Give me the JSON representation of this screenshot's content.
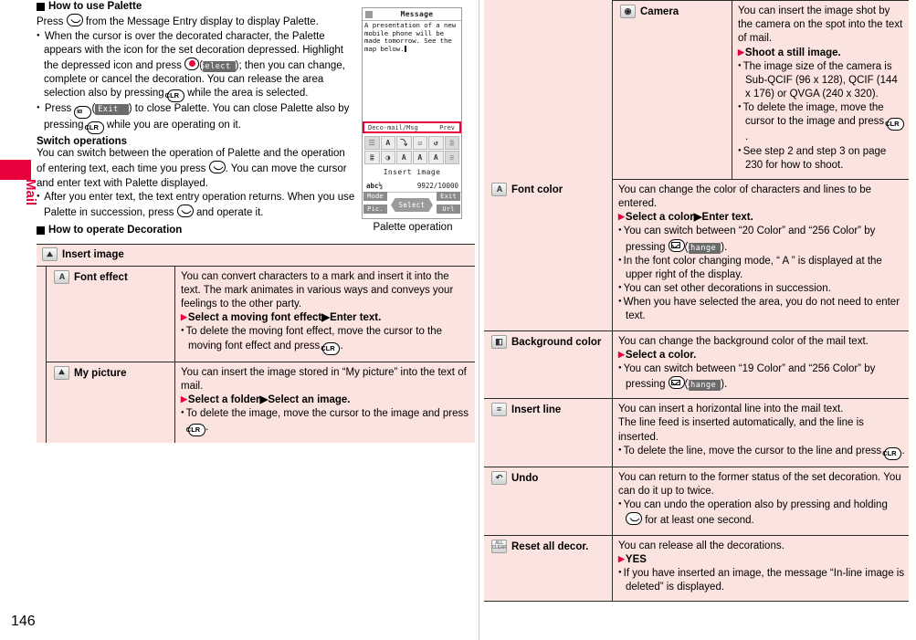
{
  "page": {
    "number": "146",
    "side_tab": "Mail",
    "accent": "#e8003c",
    "table_bg": "#fbe3e0"
  },
  "left": {
    "h1": "How to use Palette",
    "p1_a": "Press",
    "p1_b": "from the Message Entry display to display Palette.",
    "b1": "When the cursor is over the decorated character, the Palette appears with the icon for the set decoration depressed. Highlight the depressed icon and press",
    "b1_softkey": "Select",
    "b1_cont": "); then you can change, complete or cancel the decoration. You can release the area selection also by pressing",
    "b1_end": "while the area is selected.",
    "b2_a": "Press",
    "b2_key": "iα",
    "b2_softkey": "Exit",
    "b2_b": ") to close Palette. You can close Palette also by pressing",
    "b2_c": "while you are operating on it.",
    "h2": "Switch operations",
    "p2_a": "You can switch between the operation of Palette and the operation of entering text, each time you press",
    "p2_b": ". You can move the cursor and enter text with Palette displayed.",
    "b3_a": "After you enter text, the text entry operation returns. When you use Palette in succession, press",
    "b3_b": "and operate it.",
    "h3": "How to operate Decoration"
  },
  "figure": {
    "caption": "Palette operation",
    "screen_title": "Message",
    "screen_body": "A presentation of a new mobile phone will be made tomorrow. See the map below.",
    "tab_left": "Deco-mail/Msg",
    "tab_right": "Prev",
    "palette_caption": "Insert image",
    "counter_left": "abc½",
    "counter_right": "9922/10000",
    "softkey_mode": "Mode",
    "softkey_exit": "Exit",
    "softkey_pic": "Pic.",
    "softkey_url": "Url",
    "softkey_select": "Select",
    "palette_row1": [
      "☰",
      "A",
      "⤵",
      "☑",
      "↺",
      "≣"
    ],
    "palette_row2": [
      "≣",
      "◑",
      "A",
      "A",
      "A",
      "≡"
    ]
  },
  "groups": [
    {
      "name": "insert-image",
      "icon": "image-icon",
      "label": "Insert image",
      "rows": [
        {
          "name": "font-effect",
          "icon": "font-effect-icon",
          "icon_glyph": "A",
          "label": "Font effect",
          "desc": [
            {
              "type": "p",
              "text": "You can convert characters to a mark and insert it into the text. The mark animates in various ways and conveys your feelings to the other party."
            },
            {
              "type": "step",
              "text": "Select a moving font effect▶Enter text."
            },
            {
              "type": "bullet_key",
              "text_before": "To delete the moving font effect, move the cursor to the moving font effect and press",
              "key": "CLR",
              "text_after": "."
            }
          ]
        },
        {
          "name": "my-picture",
          "icon": "my-picture-icon",
          "icon_glyph": "⛰",
          "label": "My picture",
          "desc": [
            {
              "type": "p",
              "text": "You can insert the image stored in “My picture” into the text of mail."
            },
            {
              "type": "step",
              "text": "Select a folder▶Select an image."
            },
            {
              "type": "bullet_key",
              "text_before": "To delete the image, move the cursor to the image and press",
              "key": "CLR",
              "text_after": "."
            }
          ]
        },
        {
          "name": "camera",
          "icon": "camera-icon",
          "icon_glyph": "◉",
          "label": "Camera",
          "desc": [
            {
              "type": "p",
              "text": "You can insert the image shot by the camera on the spot into the text of mail."
            },
            {
              "type": "step",
              "text": "Shoot a still image."
            },
            {
              "type": "bullet",
              "text": "The image size of the camera is Sub-QCIF (96 x 128), QCIF (144 x 176) or QVGA (240 x 320)."
            },
            {
              "type": "bullet_key",
              "text_before": "To delete the image, move the cursor to the image and press",
              "key": "CLR",
              "text_after": "."
            },
            {
              "type": "bullet",
              "text": "See step 2 and step 3 on page 230 for how to shoot."
            }
          ]
        }
      ]
    }
  ],
  "rows_right": [
    {
      "name": "font-color",
      "icon": "font-color-icon",
      "icon_glyph": "A",
      "label": "Font color",
      "desc": [
        {
          "type": "p",
          "text": "You can change the color of characters and lines to be entered."
        },
        {
          "type": "step",
          "text": "Select a color▶Enter text."
        },
        {
          "type": "bullet_mail",
          "text_before": "You can switch between “20 Color” and “256 Color” by pressing",
          "softkey": "Change",
          "text_after": ")."
        },
        {
          "type": "bullet",
          "text": "In the font color changing mode, “ A ” is displayed at the upper right of the display."
        },
        {
          "type": "bullet",
          "text": "You can set other decorations in succession."
        },
        {
          "type": "bullet",
          "text": "When you have selected the area, you do not need to enter text."
        }
      ]
    },
    {
      "name": "background-color",
      "icon": "background-color-icon",
      "icon_glyph": "◧",
      "label": "Background color",
      "desc": [
        {
          "type": "p",
          "text": "You can change the background color of the mail text."
        },
        {
          "type": "step",
          "text": "Select a color."
        },
        {
          "type": "bullet_mail",
          "text_before": "You can switch between “19 Color” and “256 Color” by pressing",
          "softkey": "Change",
          "text_after": ")."
        }
      ]
    },
    {
      "name": "insert-line",
      "icon": "insert-line-icon",
      "icon_glyph": "≡",
      "label": "Insert line",
      "desc": [
        {
          "type": "p",
          "text": "You can insert a horizontal line into the mail text."
        },
        {
          "type": "p",
          "text": "The line feed is inserted automatically, and the line is inserted."
        },
        {
          "type": "bullet_key",
          "text_before": "To delete the line, move the cursor to the line and press",
          "key": "CLR",
          "text_after": "."
        }
      ]
    },
    {
      "name": "undo",
      "icon": "undo-icon",
      "icon_glyph": "↺",
      "label": "Undo",
      "desc": [
        {
          "type": "p",
          "text": "You can return to the former status of the set decoration. You can do it up to twice."
        },
        {
          "type": "bullet_call",
          "text_before": "You can undo the operation also by pressing and holding",
          "text_after": "for at least one second."
        }
      ]
    },
    {
      "name": "reset-all-decor",
      "icon": "reset-all-decor-icon",
      "icon_glyph": "ALL CLEAR",
      "label": "Reset all decor.",
      "desc": [
        {
          "type": "p",
          "text": "You can release all the decorations."
        },
        {
          "type": "step",
          "text": "YES"
        },
        {
          "type": "bullet",
          "text": "If you have inserted an image, the message “In-line image is deleted” is displayed."
        }
      ]
    }
  ]
}
